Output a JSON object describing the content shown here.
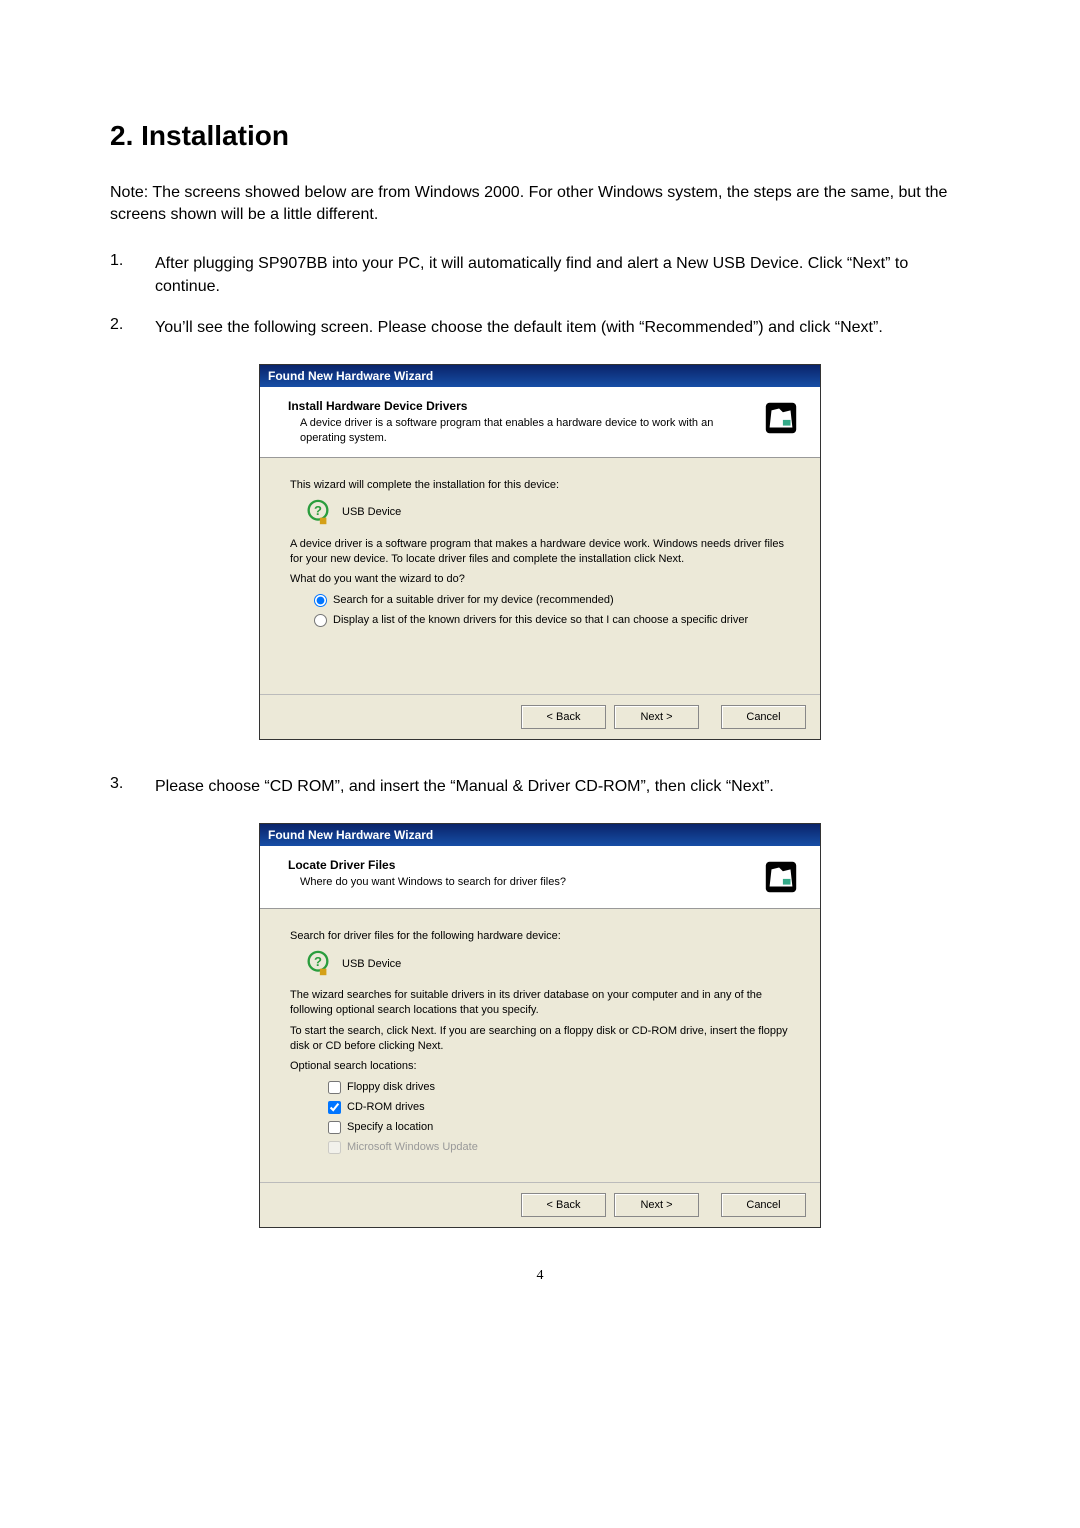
{
  "heading": "2. Installation",
  "intro": "Note: The screens showed below are from Windows 2000. For other Windows system, the steps are the same, but the screens shown will be a little different.",
  "steps": [
    {
      "num": "1.",
      "text": "After plugging SP907BB into your PC, it will automatically find and alert a New USB Device. Click “Next” to continue."
    },
    {
      "num": "2.",
      "text": "You’ll see the following screen. Please choose the default item (with “Recommended”) and click “Next”."
    },
    {
      "num": "3.",
      "text": "Please choose “CD ROM”, and insert the “Manual & Driver CD-ROM”, then click “Next”."
    }
  ],
  "dialog1": {
    "title": "Found New Hardware Wizard",
    "htitle": "Install Hardware Device Drivers",
    "hsub": "A device driver is a software program that enables a hardware device to work with an operating system.",
    "intro": "This wizard will complete the installation for this device:",
    "device": "USB Device",
    "desc": "A device driver is a software program that makes a hardware device work. Windows needs driver files for your new device. To locate driver files and complete the installation click Next.",
    "question": "What do you want the wizard to do?",
    "opt1": "Search for a suitable driver for my device (recommended)",
    "opt2": "Display a list of the known drivers for this device so that I can choose a specific driver",
    "back": "< Back",
    "next": "Next >",
    "cancel": "Cancel"
  },
  "dialog2": {
    "title": "Found New Hardware Wizard",
    "htitle": "Locate Driver Files",
    "hsub": "Where do you want Windows to search for driver files?",
    "intro": "Search for driver files for the following hardware device:",
    "device": "USB Device",
    "desc1": "The wizard searches for suitable drivers in its driver database on your computer and in any of the following optional search locations that you specify.",
    "desc2": "To start the search, click Next. If you are searching on a floppy disk or CD-ROM drive, insert the floppy disk or CD before clicking Next.",
    "optlabel": "Optional search locations:",
    "chk1": "Floppy disk drives",
    "chk2": "CD-ROM drives",
    "chk3": "Specify a location",
    "chk4": "Microsoft Windows Update",
    "back": "< Back",
    "next": "Next >",
    "cancel": "Cancel"
  },
  "pagenum": "4"
}
